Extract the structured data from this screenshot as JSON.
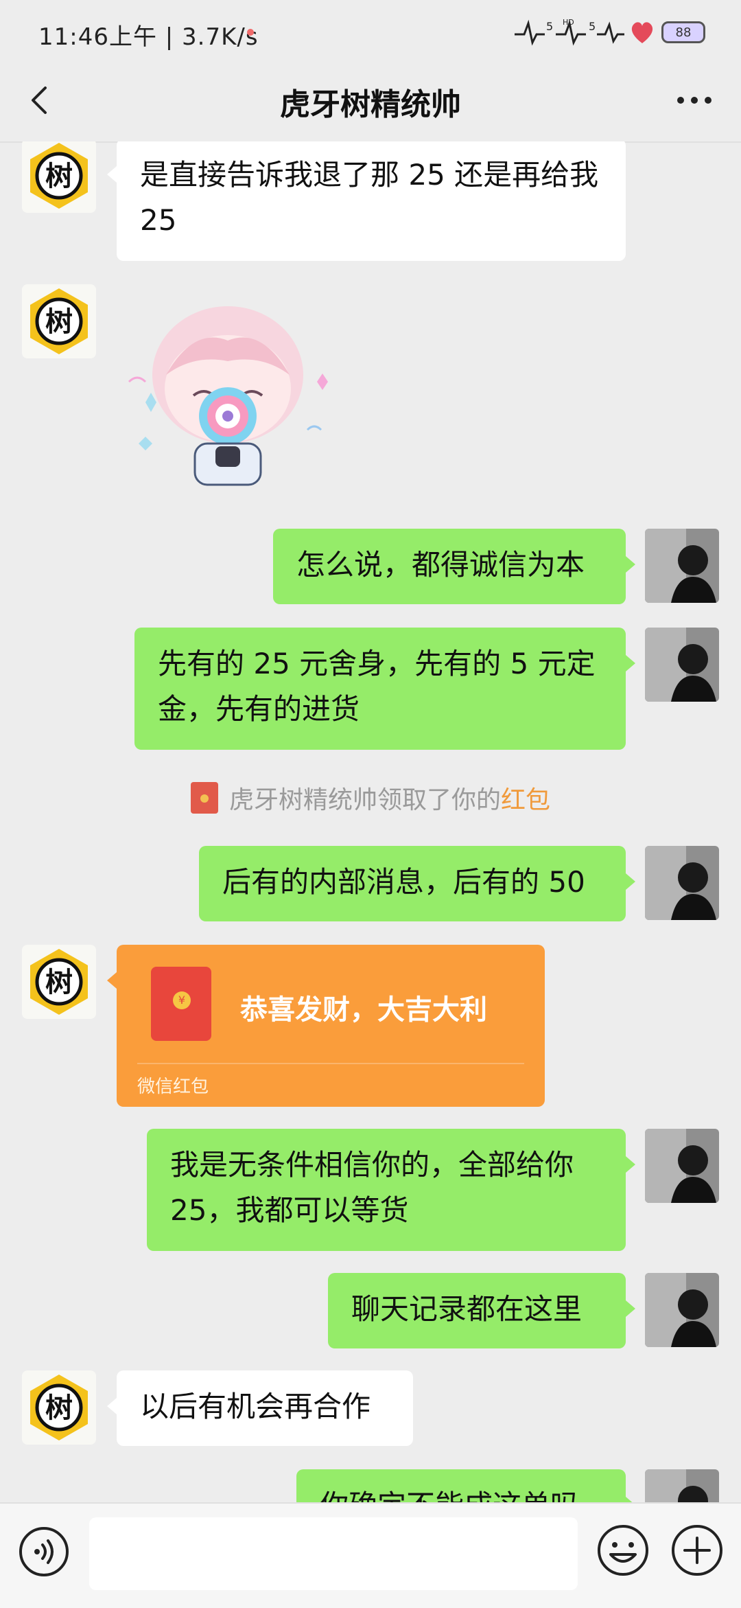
{
  "status_bar": {
    "time": "11:46上午 | 3.7K/s",
    "signal_label_1": "5",
    "signal_hd": "HD",
    "signal_label_2": "5",
    "battery": "88"
  },
  "nav": {
    "title": "虎牙树精统帅",
    "back_icon": "chevron-left-icon",
    "more_icon": "more-dots-icon"
  },
  "contact": {
    "avatar_char": "树"
  },
  "messages": [
    {
      "from": "them",
      "type": "text",
      "text": "是直接告诉我退了那 25 还是再给我 25"
    },
    {
      "from": "them",
      "type": "sticker",
      "sticker": "anime-girl-lollipop-sticker"
    },
    {
      "from": "me",
      "type": "text",
      "text": "怎么说，都得诚信为本"
    },
    {
      "from": "me",
      "type": "text",
      "text": "先有的 25 元舍身，先有的 5 元定金，先有的进货"
    },
    {
      "from": "system",
      "type": "notice",
      "prefix": "虎牙树精统帅领取了你的",
      "highlight": "红包"
    },
    {
      "from": "me",
      "type": "text",
      "text": "后有的内部消息，后有的 50"
    },
    {
      "from": "them",
      "type": "red_packet",
      "greeting": "恭喜发财，大吉大利",
      "footer": "微信红包",
      "coin": "¥"
    },
    {
      "from": "me",
      "type": "text",
      "text": "我是无条件相信你的，全部给你 25，我都可以等货"
    },
    {
      "from": "me",
      "type": "text",
      "text": "聊天记录都在这里"
    },
    {
      "from": "them",
      "type": "text",
      "text": "以后有机会再合作"
    },
    {
      "from": "me",
      "type": "text",
      "text": "你确定不能成这单吗"
    }
  ],
  "input_bar": {
    "placeholder": "",
    "voice_icon": "voice-icon",
    "emoji_icon": "emoji-icon",
    "plus_icon": "plus-icon"
  },
  "colors": {
    "background": "#ededed",
    "incoming_bubble": "#ffffff",
    "outgoing_bubble": "#95ec69",
    "red_packet": "#fa9d3b",
    "highlight": "#f09a3b"
  }
}
